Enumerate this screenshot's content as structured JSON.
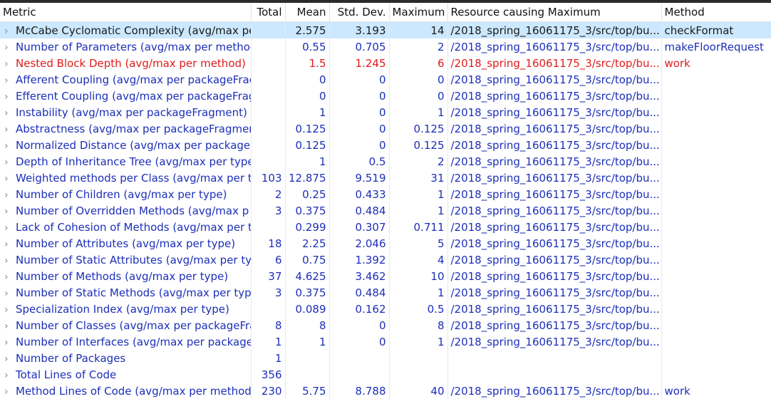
{
  "headers": {
    "metric": "Metric",
    "total": "Total",
    "mean": "Mean",
    "std": "Std. Dev.",
    "max": "Maximum",
    "resource": "Resource causing Maximum",
    "method": "Method"
  },
  "colors": {
    "link_text": "#1c2fb8",
    "warning_text": "#e01b1b",
    "selection_bg": "#cce8ff"
  },
  "expand_icon": "chevron-right-icon",
  "expand_glyph": "›",
  "rows": [
    {
      "metric": "McCabe Cyclomatic Complexity (avg/max pe",
      "total": "",
      "mean": "2.575",
      "std": "3.193",
      "max": "14",
      "resource": "/2018_spring_16061175_3/src/top/bu...",
      "method": "checkFormat",
      "state": "selected"
    },
    {
      "metric": "Number of Parameters (avg/max per methoc",
      "total": "",
      "mean": "0.55",
      "std": "0.705",
      "max": "2",
      "resource": "/2018_spring_16061175_3/src/top/bu...",
      "method": "makeFloorRequest",
      "state": ""
    },
    {
      "metric": "Nested Block Depth (avg/max per method)",
      "total": "",
      "mean": "1.5",
      "std": "1.245",
      "max": "6",
      "resource": "/2018_spring_16061175_3/src/top/bu...",
      "method": "work",
      "state": "warning"
    },
    {
      "metric": "Afferent Coupling (avg/max per packageFrac",
      "total": "",
      "mean": "0",
      "std": "0",
      "max": "0",
      "resource": "/2018_spring_16061175_3/src/top/bu...",
      "method": "",
      "state": ""
    },
    {
      "metric": "Efferent Coupling (avg/max per packageFrag",
      "total": "",
      "mean": "0",
      "std": "0",
      "max": "0",
      "resource": "/2018_spring_16061175_3/src/top/bu...",
      "method": "",
      "state": ""
    },
    {
      "metric": "Instability (avg/max per packageFragment)",
      "total": "",
      "mean": "1",
      "std": "0",
      "max": "1",
      "resource": "/2018_spring_16061175_3/src/top/bu...",
      "method": "",
      "state": ""
    },
    {
      "metric": "Abstractness (avg/max per packageFragmen",
      "total": "",
      "mean": "0.125",
      "std": "0",
      "max": "0.125",
      "resource": "/2018_spring_16061175_3/src/top/bu...",
      "method": "",
      "state": ""
    },
    {
      "metric": "Normalized Distance (avg/max per packageF",
      "total": "",
      "mean": "0.125",
      "std": "0",
      "max": "0.125",
      "resource": "/2018_spring_16061175_3/src/top/bu...",
      "method": "",
      "state": ""
    },
    {
      "metric": "Depth of Inheritance Tree (avg/max per type",
      "total": "",
      "mean": "1",
      "std": "0.5",
      "max": "2",
      "resource": "/2018_spring_16061175_3/src/top/bu...",
      "method": "",
      "state": ""
    },
    {
      "metric": "Weighted methods per Class (avg/max per ty",
      "total": "103",
      "mean": "12.875",
      "std": "9.519",
      "max": "31",
      "resource": "/2018_spring_16061175_3/src/top/bu...",
      "method": "",
      "state": ""
    },
    {
      "metric": "Number of Children (avg/max per type)",
      "total": "2",
      "mean": "0.25",
      "std": "0.433",
      "max": "1",
      "resource": "/2018_spring_16061175_3/src/top/bu...",
      "method": "",
      "state": ""
    },
    {
      "metric": "Number of Overridden Methods (avg/max p",
      "total": "3",
      "mean": "0.375",
      "std": "0.484",
      "max": "1",
      "resource": "/2018_spring_16061175_3/src/top/bu...",
      "method": "",
      "state": ""
    },
    {
      "metric": "Lack of Cohesion of Methods (avg/max per t",
      "total": "",
      "mean": "0.299",
      "std": "0.307",
      "max": "0.711",
      "resource": "/2018_spring_16061175_3/src/top/bu...",
      "method": "",
      "state": ""
    },
    {
      "metric": "Number of Attributes (avg/max per type)",
      "total": "18",
      "mean": "2.25",
      "std": "2.046",
      "max": "5",
      "resource": "/2018_spring_16061175_3/src/top/bu...",
      "method": "",
      "state": ""
    },
    {
      "metric": "Number of Static Attributes (avg/max per ty|",
      "total": "6",
      "mean": "0.75",
      "std": "1.392",
      "max": "4",
      "resource": "/2018_spring_16061175_3/src/top/bu...",
      "method": "",
      "state": ""
    },
    {
      "metric": "Number of Methods (avg/max per type)",
      "total": "37",
      "mean": "4.625",
      "std": "3.462",
      "max": "10",
      "resource": "/2018_spring_16061175_3/src/top/bu...",
      "method": "",
      "state": ""
    },
    {
      "metric": "Number of Static Methods (avg/max per typ",
      "total": "3",
      "mean": "0.375",
      "std": "0.484",
      "max": "1",
      "resource": "/2018_spring_16061175_3/src/top/bu...",
      "method": "",
      "state": ""
    },
    {
      "metric": "Specialization Index (avg/max per type)",
      "total": "",
      "mean": "0.089",
      "std": "0.162",
      "max": "0.5",
      "resource": "/2018_spring_16061175_3/src/top/bu...",
      "method": "",
      "state": ""
    },
    {
      "metric": "Number of Classes (avg/max per packageFra",
      "total": "8",
      "mean": "8",
      "std": "0",
      "max": "8",
      "resource": "/2018_spring_16061175_3/src/top/bu...",
      "method": "",
      "state": ""
    },
    {
      "metric": "Number of Interfaces (avg/max per packagel",
      "total": "1",
      "mean": "1",
      "std": "0",
      "max": "1",
      "resource": "/2018_spring_16061175_3/src/top/bu...",
      "method": "",
      "state": ""
    },
    {
      "metric": "Number of Packages",
      "total": "1",
      "mean": "",
      "std": "",
      "max": "",
      "resource": "",
      "method": "",
      "state": ""
    },
    {
      "metric": "Total Lines of Code",
      "total": "356",
      "mean": "",
      "std": "",
      "max": "",
      "resource": "",
      "method": "",
      "state": ""
    },
    {
      "metric": "Method Lines of Code (avg/max per method",
      "total": "230",
      "mean": "5.75",
      "std": "8.788",
      "max": "40",
      "resource": "/2018_spring_16061175_3/src/top/bu...",
      "method": "work",
      "state": ""
    }
  ]
}
